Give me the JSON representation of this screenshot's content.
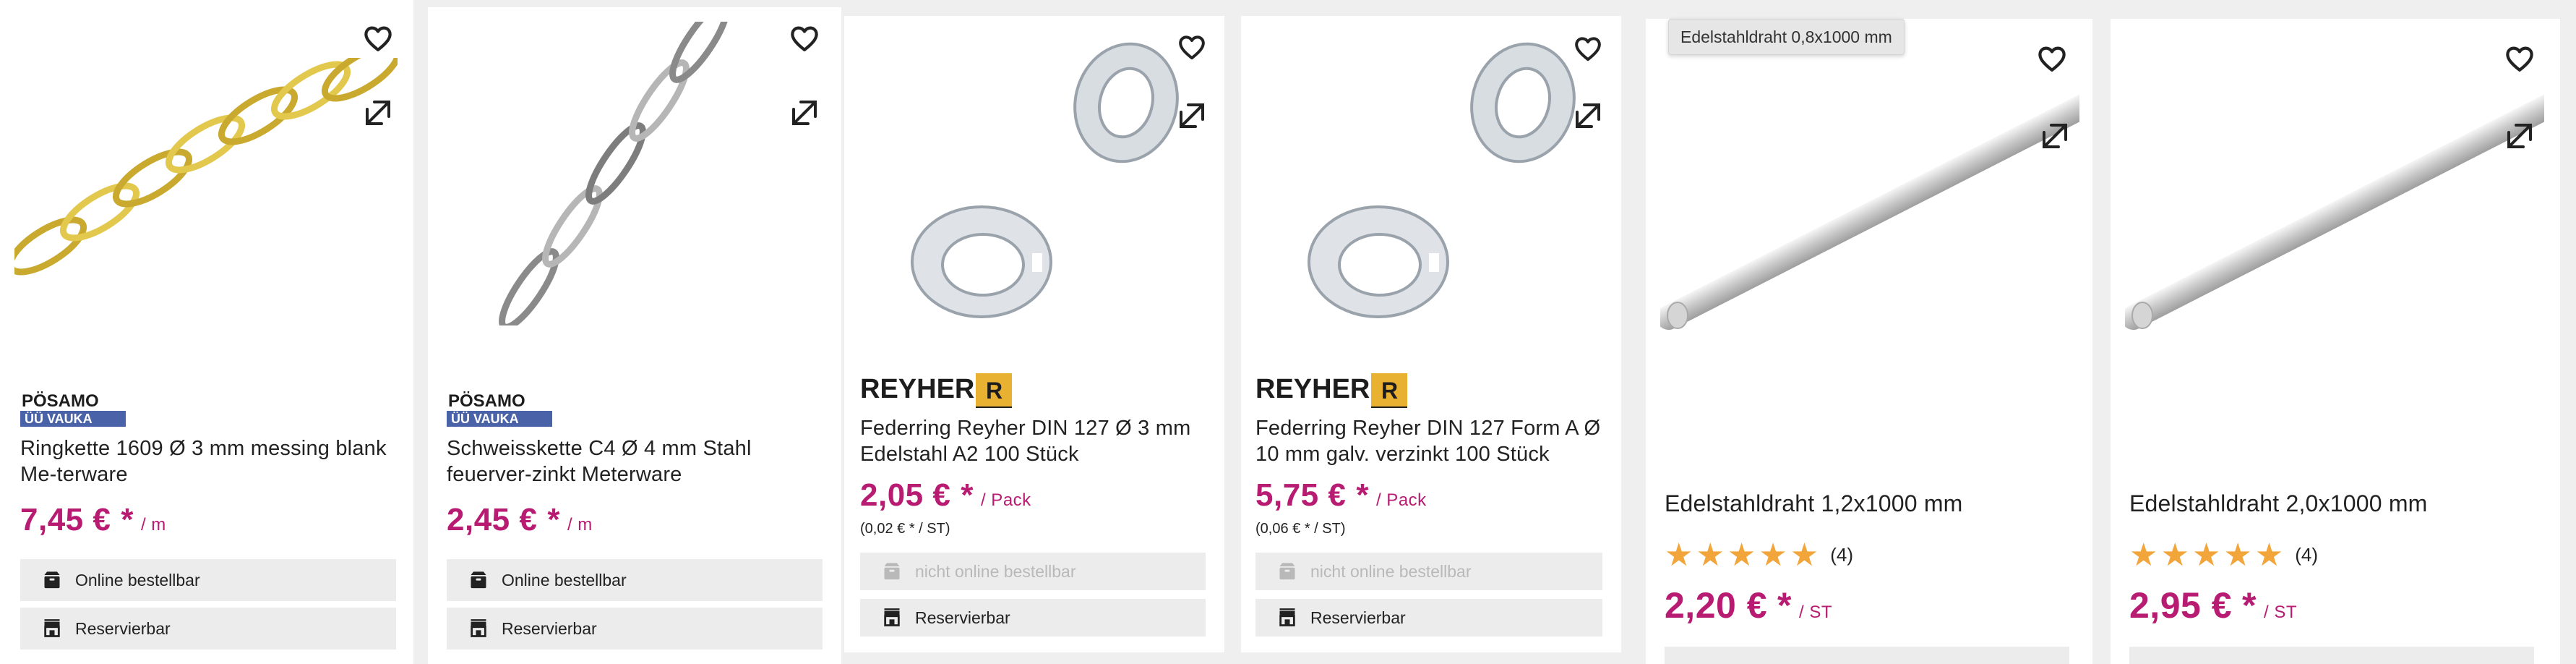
{
  "products": [
    {
      "brand": "PÖSAMO VAUKA",
      "title": "Ringkette 1609 Ø 3 mm messing blank Me-terware",
      "price": "7,45 €",
      "star": "*",
      "unit": "/ m",
      "actions": [
        "Online bestellbar",
        "Reservierbar"
      ]
    },
    {
      "brand": "PÖSAMO VAUKA",
      "title": "Schweisskette C4 Ø 4 mm Stahl feuerver-zinkt Meterware",
      "price": "2,45 €",
      "star": "*",
      "unit": "/ m",
      "actions": [
        "Online bestellbar",
        "Reservierbar"
      ]
    },
    {
      "brand": "REYHER",
      "brand_letter": "R",
      "title": "Federring Reyher DIN 127 Ø 3 mm Edelstahl A2 100 Stück",
      "price": "2,05 €",
      "star": "*",
      "unit": "/ Pack",
      "base_price": "(0,02 € * / ST)",
      "actions": [
        "nicht online bestellbar",
        "Reservierbar"
      ]
    },
    {
      "brand": "REYHER",
      "brand_letter": "R",
      "title": "Federring Reyher DIN 127 Form A Ø 10 mm galv. verzinkt 100 Stück",
      "price": "5,75 €",
      "star": "*",
      "unit": "/ Pack",
      "base_price": "(0,06 € * / ST)",
      "actions": [
        "nicht online bestellbar",
        "Reservierbar"
      ]
    },
    {
      "tooltip": "Edelstahldraht 0,8x1000 mm",
      "title": "Edelstahldraht 1,2x1000 mm",
      "rating_stars": "★★★★★",
      "rating_count": "(4)",
      "price": "2,20 €",
      "star": "*",
      "unit": "/ ST"
    },
    {
      "title": "Edelstahldraht 2,0x1000 mm",
      "rating_stars": "★★★★★",
      "rating_count": "(4)",
      "price": "2,95 €",
      "star": "*",
      "unit": "/ ST"
    }
  ],
  "icons": {
    "wishlist": "heart-icon",
    "compare": "compare-arrows-icon",
    "online": "box-icon",
    "reserve": "store-icon"
  },
  "colors": {
    "price": "#b81b72",
    "stars": "#f2a53a",
    "reyher_yellow": "#e8b131",
    "posamo_blue": "#4a63a8"
  }
}
